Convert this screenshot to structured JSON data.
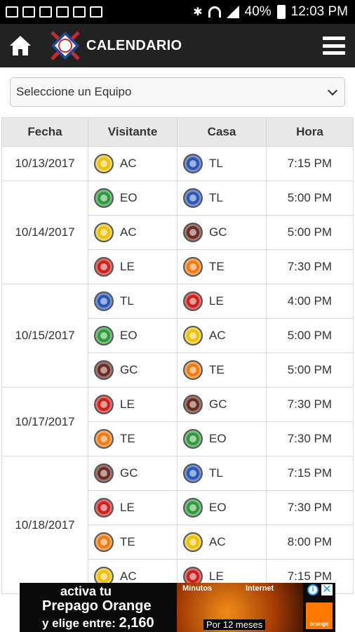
{
  "status": {
    "battery": "40%",
    "time": "12:03 PM"
  },
  "appbar": {
    "title": "CALENDARIO"
  },
  "team_select": {
    "placeholder": "Seleccione un Equipo"
  },
  "table": {
    "headers": [
      "Fecha",
      "Visitante",
      "Casa",
      "Hora"
    ],
    "rows": [
      {
        "date": "10/13/2017",
        "away": "AC",
        "home": "TL",
        "time": "7:15 PM"
      },
      {
        "date": "10/14/2017",
        "away": "EO",
        "home": "TL",
        "time": "5:00 PM"
      },
      {
        "date": "",
        "away": "AC",
        "home": "GC",
        "time": "5:00 PM"
      },
      {
        "date": "",
        "away": "LE",
        "home": "TE",
        "time": "7:30 PM"
      },
      {
        "date": "10/15/2017",
        "away": "TL",
        "home": "LE",
        "time": "4:00 PM"
      },
      {
        "date": "",
        "away": "EO",
        "home": "AC",
        "time": "5:00 PM"
      },
      {
        "date": "",
        "away": "GC",
        "home": "TE",
        "time": "5:00 PM"
      },
      {
        "date": "10/17/2017",
        "away": "LE",
        "home": "GC",
        "time": "7:30 PM"
      },
      {
        "date": "",
        "away": "TE",
        "home": "EO",
        "time": "7:30 PM"
      },
      {
        "date": "10/18/2017",
        "away": "GC",
        "home": "TL",
        "time": "7:15 PM"
      },
      {
        "date": "",
        "away": "LE",
        "home": "EO",
        "time": "7:30 PM"
      },
      {
        "date": "",
        "away": "TE",
        "home": "AC",
        "time": "8:00 PM"
      },
      {
        "date": "",
        "away": "AC",
        "home": "LE",
        "time": "7:15 PM"
      }
    ]
  },
  "ad": {
    "line1": "activa tu",
    "line2": "Prepago Orange",
    "line3": "y elige entre:",
    "line3_value": "2,160",
    "minutos": "Minutos",
    "internet": "Internet",
    "por": "Por 12 meses",
    "brand": "orange"
  }
}
